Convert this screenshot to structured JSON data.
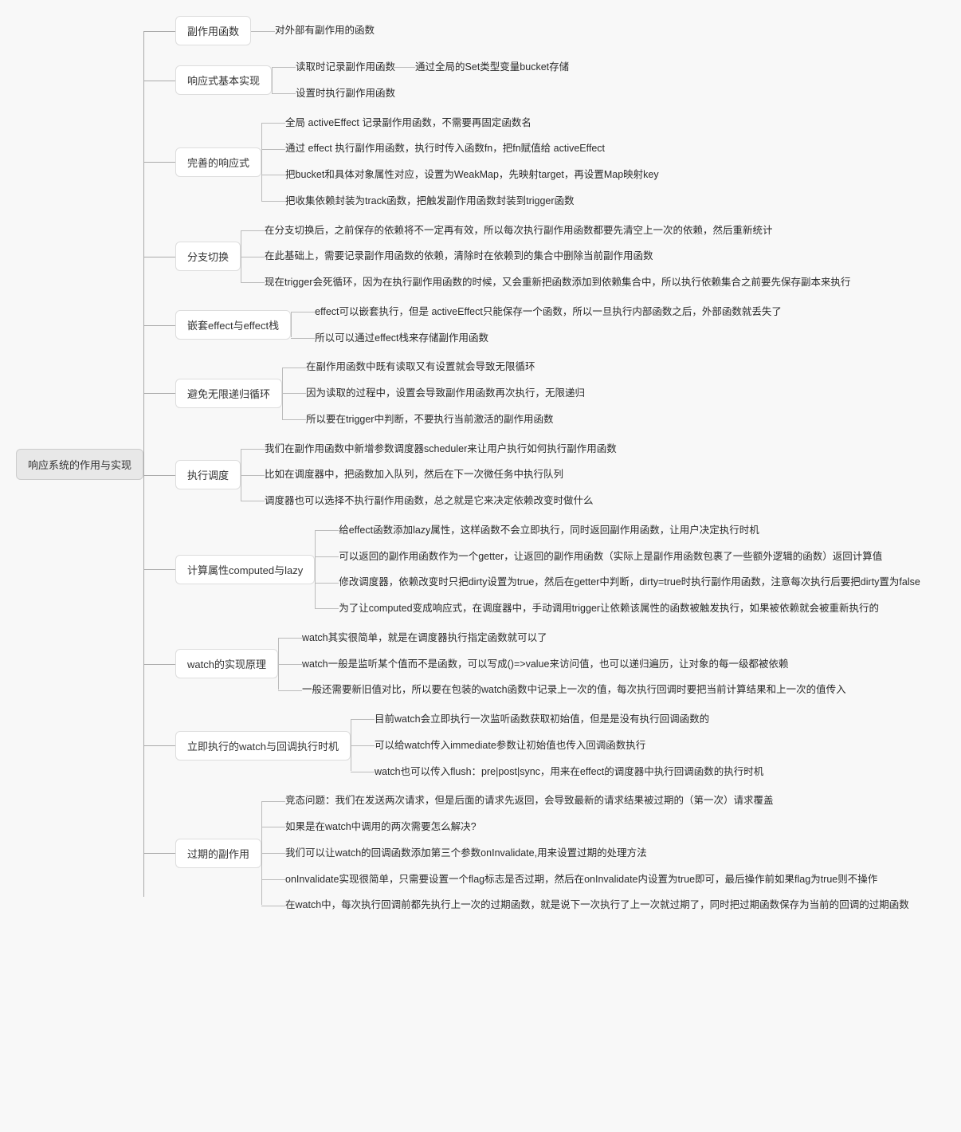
{
  "root": "响应系统的作用与实现",
  "nodes": [
    {
      "title": "副作用函数",
      "children": [
        {
          "text": "对外部有副作用的函数"
        }
      ]
    },
    {
      "title": "响应式基本实现",
      "children": [
        {
          "text": "读取时记录副作用函数",
          "sub": "通过全局的Set类型变量bucket存储"
        },
        {
          "text": "设置时执行副作用函数"
        }
      ]
    },
    {
      "title": "完善的响应式",
      "children": [
        {
          "text": "全局 activeEffect 记录副作用函数，不需要再固定函数名"
        },
        {
          "text": "通过 effect 执行副作用函数，执行时传入函数fn，把fn赋值给 activeEffect"
        },
        {
          "text": "把bucket和具体对象属性对应，设置为WeakMap，先映射target，再设置Map映射key"
        },
        {
          "text": "把收集依赖封装为track函数，把触发副作用函数封装到trigger函数"
        }
      ]
    },
    {
      "title": "分支切换",
      "children": [
        {
          "text": "在分支切换后，之前保存的依赖将不一定再有效，所以每次执行副作用函数都要先清空上一次的依赖，然后重新统计"
        },
        {
          "text": "在此基础上，需要记录副作用函数的依赖，清除时在依赖到的集合中删除当前副作用函数"
        },
        {
          "text": "现在trigger会死循环，因为在执行副作用函数的时候，又会重新把函数添加到依赖集合中，所以执行依赖集合之前要先保存副本来执行"
        }
      ]
    },
    {
      "title": "嵌套effect与effect栈",
      "children": [
        {
          "text": "effect可以嵌套执行，但是 activeEffect只能保存一个函数，所以一旦执行内部函数之后，外部函数就丢失了"
        },
        {
          "text": "所以可以通过effect栈来存储副作用函数"
        }
      ]
    },
    {
      "title": "避免无限递归循环",
      "children": [
        {
          "text": "在副作用函数中既有读取又有设置就会导致无限循环"
        },
        {
          "text": "因为读取的过程中，设置会导致副作用函数再次执行，无限递归"
        },
        {
          "text": "所以要在trigger中判断，不要执行当前激活的副作用函数"
        }
      ]
    },
    {
      "title": "执行调度",
      "children": [
        {
          "text": "我们在副作用函数中新增参数调度器scheduler来让用户执行如何执行副作用函数"
        },
        {
          "text": "比如在调度器中，把函数加入队列，然后在下一次微任务中执行队列"
        },
        {
          "text": "调度器也可以选择不执行副作用函数，总之就是它来决定依赖改变时做什么"
        }
      ]
    },
    {
      "title": "计算属性computed与lazy",
      "children": [
        {
          "text": "给effect函数添加lazy属性，这样函数不会立即执行，同时返回副作用函数，让用户决定执行时机"
        },
        {
          "text": "可以返回的副作用函数作为一个getter，让返回的副作用函数（实际上是副作用函数包裹了一些额外逻辑的函数）返回计算值"
        },
        {
          "text": "修改调度器，依赖改变时只把dirty设置为true，然后在getter中判断，dirty=true时执行副作用函数，注意每次执行后要把dirty置为false"
        },
        {
          "text": "为了让computed变成响应式，在调度器中，手动调用trigger让依赖该属性的函数被触发执行，如果被依赖就会被重新执行的"
        }
      ]
    },
    {
      "title": "watch的实现原理",
      "children": [
        {
          "text": "watch其实很简单，就是在调度器执行指定函数就可以了"
        },
        {
          "text": "watch一般是监听某个值而不是函数，可以写成()=>value来访问值，也可以递归遍历，让对象的每一级都被依赖"
        },
        {
          "text": "一般还需要新旧值对比，所以要在包装的watch函数中记录上一次的值，每次执行回调时要把当前计算结果和上一次的值传入"
        }
      ]
    },
    {
      "title": "立即执行的watch与回调执行时机",
      "children": [
        {
          "text": "目前watch会立即执行一次监听函数获取初始值，但是是没有执行回调函数的"
        },
        {
          "text": "可以给watch传入immediate参数让初始值也传入回调函数执行"
        },
        {
          "text": "watch也可以传入flush：pre|post|sync，用来在effect的调度器中执行回调函数的执行时机"
        }
      ]
    },
    {
      "title": "过期的副作用",
      "children": [
        {
          "text": "竞态问题：我们在发送两次请求，但是后面的请求先返回，会导致最新的请求结果被过期的（第一次）请求覆盖"
        },
        {
          "text": "如果是在watch中调用的两次需要怎么解决?"
        },
        {
          "text": "我们可以让watch的回调函数添加第三个参数onInvalidate,用来设置过期的处理方法"
        },
        {
          "text": "onInvalidate实现很简单，只需要设置一个flag标志是否过期，然后在onInvalidate内设置为true即可，最后操作前如果flag为true则不操作"
        },
        {
          "text": "在watch中，每次执行回调前都先执行上一次的过期函数，就是说下一次执行了上一次就过期了，同时把过期函数保存为当前的回调的过期函数"
        }
      ]
    }
  ]
}
